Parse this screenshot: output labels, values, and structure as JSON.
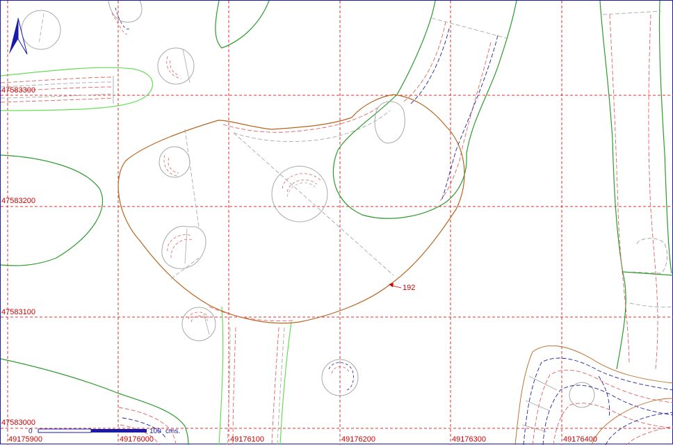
{
  "colors": {
    "grid": "#e0302a",
    "contour_brown": "#b8641e",
    "contour_green": "#2c9a2c",
    "contour_lightgreen": "#66dd55",
    "outline_gray": "#a8a8a8",
    "dash_red": "#e06060",
    "dash_blue": "#2020a0",
    "frame_blue": "#1a1aa8"
  },
  "north_arrow": {
    "icon": "north-arrow-icon"
  },
  "grid": {
    "x_labels": [
      "49175900",
      "49176000",
      "49176100",
      "49176200",
      "49176300",
      "49176400"
    ],
    "y_labels": [
      "47583300",
      "47583200",
      "47583100",
      "47583000"
    ]
  },
  "contour_label": "192",
  "scale_bar": {
    "start": "0",
    "end": "100",
    "unit": "cms."
  }
}
